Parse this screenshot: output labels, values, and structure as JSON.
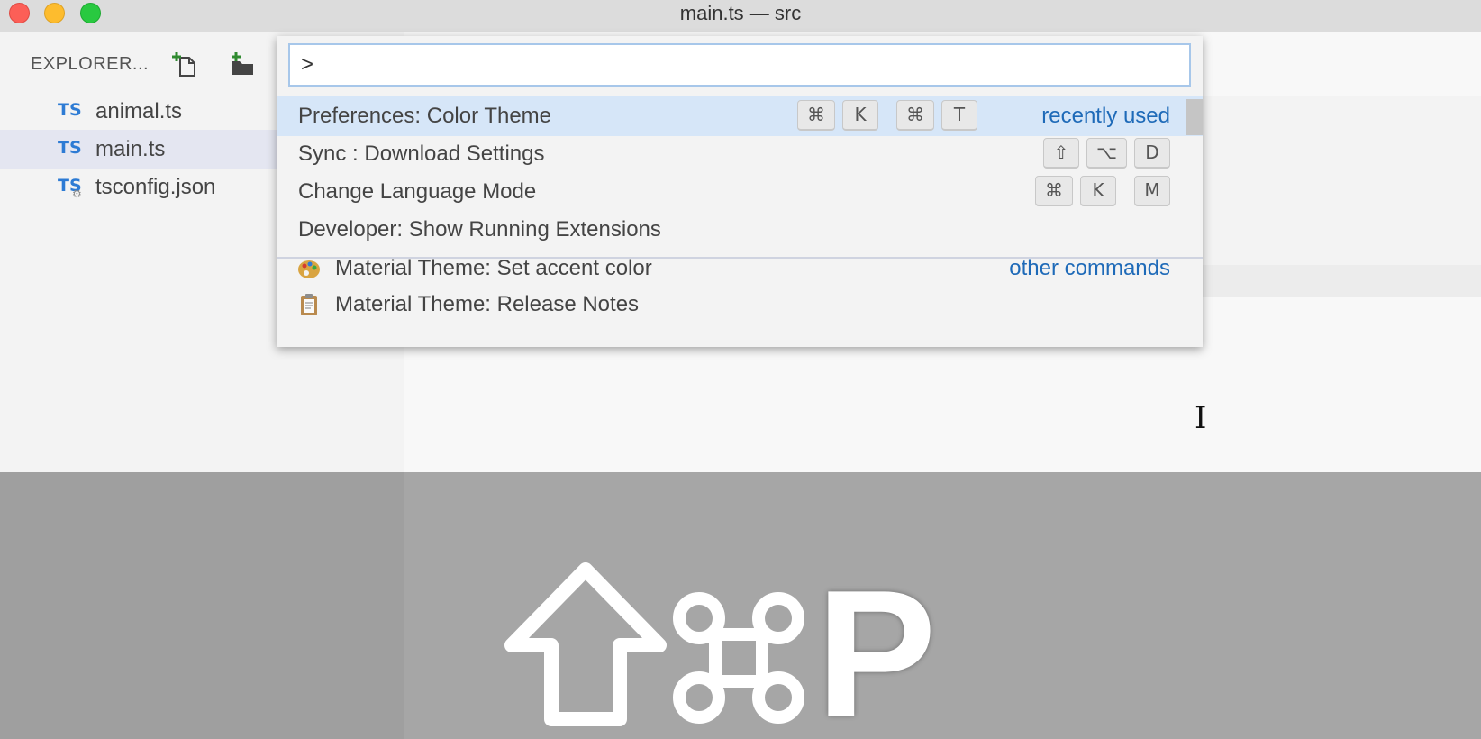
{
  "window": {
    "title": "main.ts — src"
  },
  "sidebar": {
    "title": "EXPLORER...",
    "files": [
      {
        "badge": "TS",
        "name": "animal.ts",
        "active": false
      },
      {
        "badge": "TS",
        "name": "main.ts",
        "active": true
      },
      {
        "badge": "TS",
        "name": "tsconfig.json",
        "active": false
      }
    ]
  },
  "palette": {
    "input_value": ">",
    "recent_label": "recently used",
    "other_label": "other commands",
    "commands": [
      {
        "label": "Preferences: Color Theme",
        "keys": [
          "⌘",
          "K",
          "⌘",
          "T"
        ]
      },
      {
        "label": "Sync : Download Settings",
        "keys": [
          "⇧",
          "⌥",
          "D"
        ]
      },
      {
        "label": "Change Language Mode",
        "keys": [
          "⌘",
          "K",
          "M"
        ]
      },
      {
        "label": "Developer: Show Running Extensions",
        "keys": []
      }
    ],
    "other_commands": [
      {
        "label": "Material Theme: Set accent color",
        "icon": "palette-icon"
      },
      {
        "label": "Material Theme: Release Notes",
        "icon": "clipboard-icon"
      }
    ]
  },
  "shortcut_overlay": {
    "letter": "P"
  },
  "colors": {
    "selection": "#d6e6f8",
    "accent_link": "#1e6ab8",
    "ts_badge": "#2d7bd4"
  }
}
